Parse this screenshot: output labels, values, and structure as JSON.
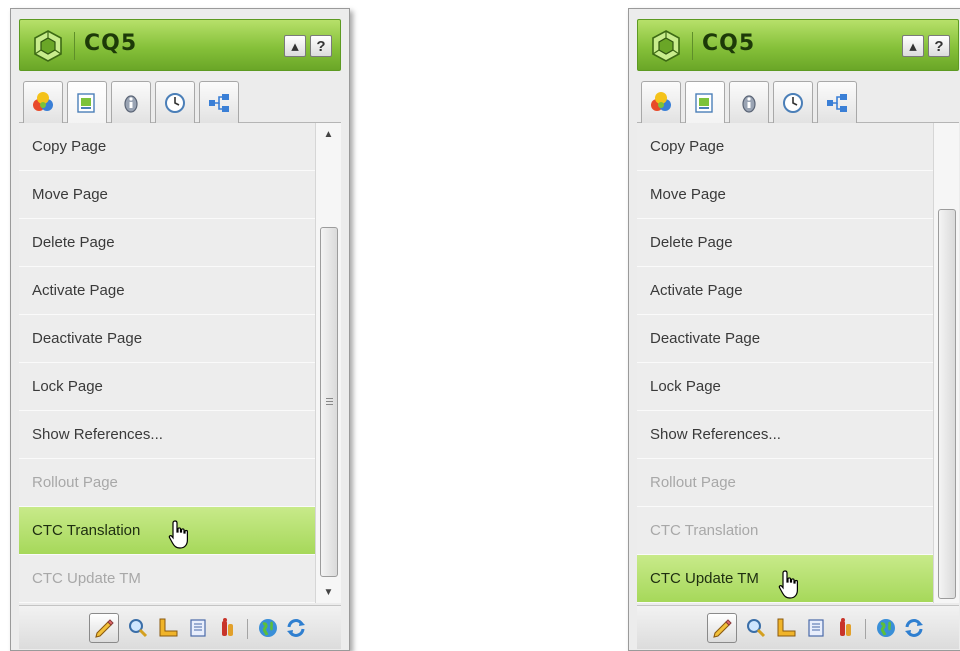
{
  "panels": [
    {
      "app_title": "CQ5",
      "collapse_glyph": "▴",
      "help_glyph": "?",
      "menu_items": [
        {
          "label": "Copy Page",
          "state": "normal"
        },
        {
          "label": "Move Page",
          "state": "normal"
        },
        {
          "label": "Delete Page",
          "state": "normal"
        },
        {
          "label": "Activate Page",
          "state": "normal"
        },
        {
          "label": "Deactivate Page",
          "state": "normal"
        },
        {
          "label": "Lock Page",
          "state": "normal"
        },
        {
          "label": "Show References...",
          "state": "normal"
        },
        {
          "label": "Rollout Page",
          "state": "disabled"
        },
        {
          "label": "CTC Translation",
          "state": "hover"
        },
        {
          "label": "CTC Update TM",
          "state": "disabled"
        }
      ]
    },
    {
      "app_title": "CQ5",
      "collapse_glyph": "▴",
      "help_glyph": "?",
      "menu_items": [
        {
          "label": "Copy Page",
          "state": "normal"
        },
        {
          "label": "Move Page",
          "state": "normal"
        },
        {
          "label": "Delete Page",
          "state": "normal"
        },
        {
          "label": "Activate Page",
          "state": "normal"
        },
        {
          "label": "Deactivate Page",
          "state": "normal"
        },
        {
          "label": "Lock Page",
          "state": "normal"
        },
        {
          "label": "Show References...",
          "state": "normal"
        },
        {
          "label": "Rollout Page",
          "state": "disabled"
        },
        {
          "label": "CTC Translation",
          "state": "disabled"
        },
        {
          "label": "CTC Update TM",
          "state": "hover"
        }
      ]
    }
  ],
  "tabs": [
    {
      "icon": "components-icon",
      "active": false
    },
    {
      "icon": "page-icon",
      "active": true
    },
    {
      "icon": "information-icon",
      "active": false
    },
    {
      "icon": "versioning-icon",
      "active": false
    },
    {
      "icon": "workflow-icon",
      "active": false
    }
  ],
  "toolbar_icons": [
    "edit-icon",
    "preview-icon",
    "design-icon",
    "scaffolding-icon",
    "client-context-icon",
    "websites-icon",
    "refresh-icon"
  ],
  "colors": {
    "header_green": "#86c13a",
    "hover_green": "#b4e070",
    "panel_bg": "#ececec",
    "disabled_text": "#a8a8a8"
  }
}
